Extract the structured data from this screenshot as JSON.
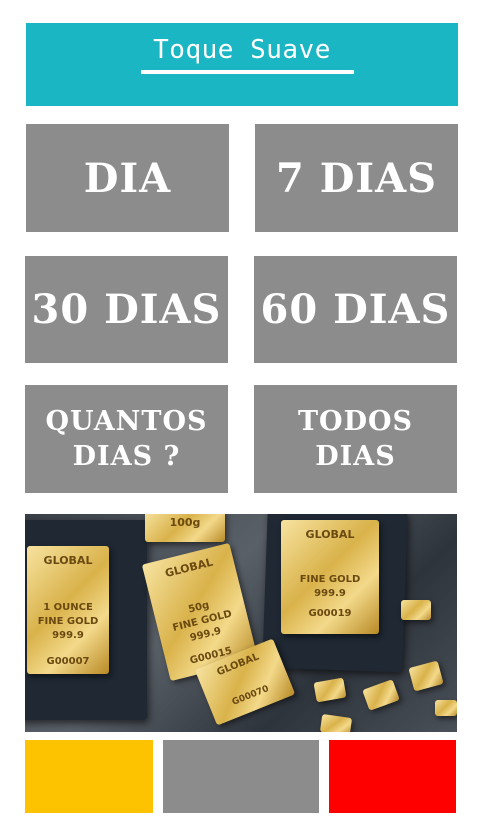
{
  "header": {
    "title": "Toque Suave"
  },
  "tiles": [
    {
      "label": "DIA"
    },
    {
      "label": "7 DIAS"
    },
    {
      "label": "30 DIAS"
    },
    {
      "label": "60 DIAS"
    },
    {
      "label_line1": "QUANTOS",
      "label_line2": "DIAS ?"
    },
    {
      "label_line1": "TODOS",
      "label_line2": "DIAS"
    }
  ],
  "photo": {
    "bars": [
      {
        "brand": "GLOBAL",
        "line1": "1 OUNCE",
        "line2": "FINE GOLD",
        "line3": "999.9",
        "serial": "G00007"
      },
      {
        "brand": "GLOBAL",
        "line1": "50g",
        "line2": "FINE GOLD",
        "line3": "999.9",
        "serial": "G00015"
      },
      {
        "brand": "GLOBAL",
        "line1": "",
        "line2": "FINE GOLD",
        "line3": "999.9",
        "serial": "G00019"
      },
      {
        "brand": "GLOBAL",
        "line1": "",
        "line2": "",
        "line3": "",
        "serial": "G00070"
      }
    ],
    "top_bar_text": "100g"
  },
  "swatches": [
    {
      "color": "#fdc300"
    },
    {
      "color": "#8c8c8c"
    },
    {
      "color": "#ff0000"
    }
  ]
}
